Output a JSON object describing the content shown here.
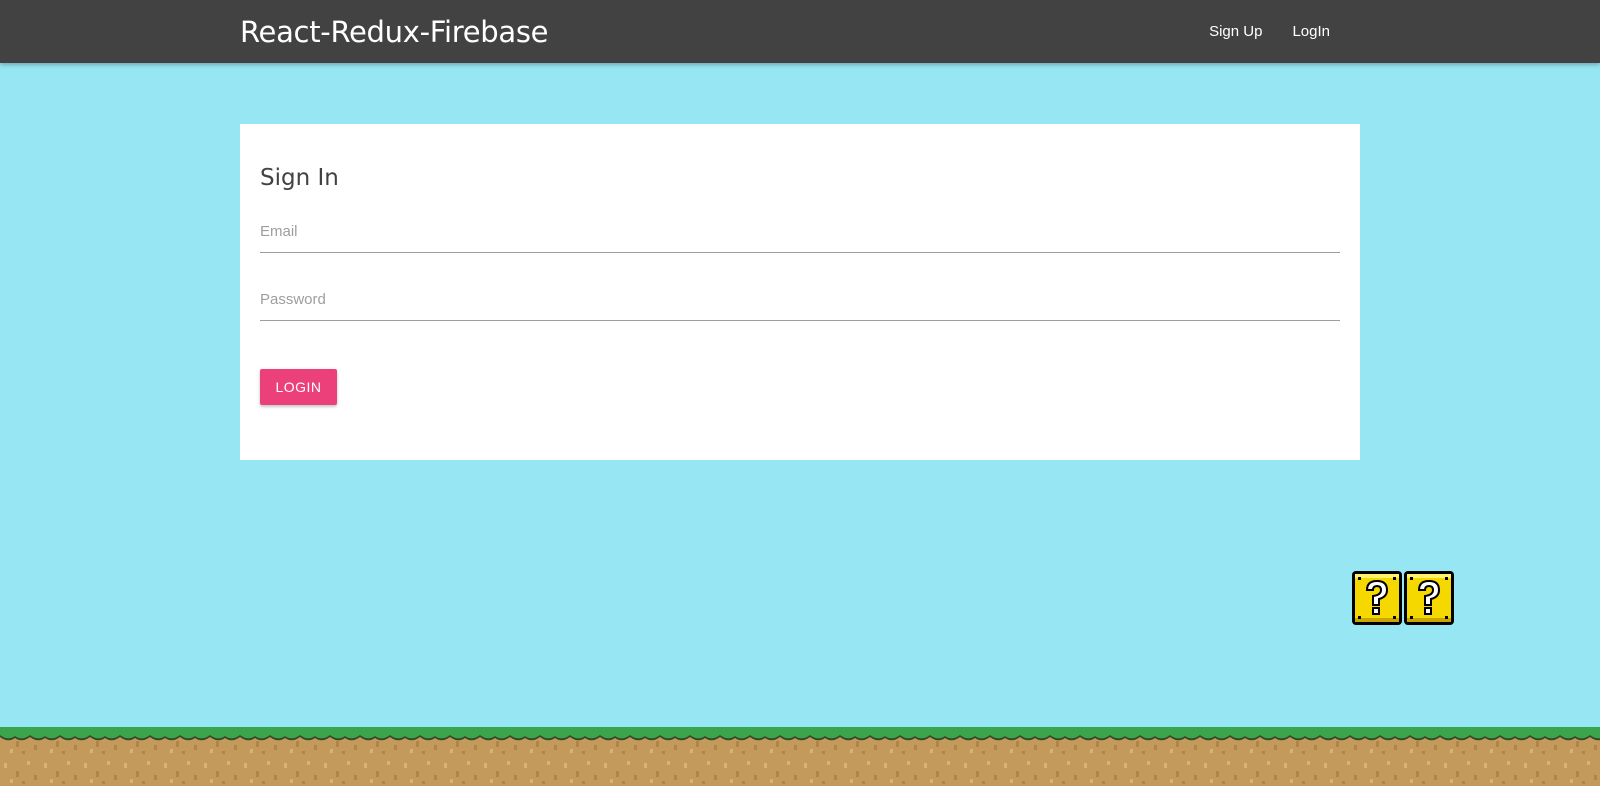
{
  "header": {
    "brand": "React-Redux-Firebase",
    "nav": [
      {
        "label": "Sign Up"
      },
      {
        "label": "LogIn"
      }
    ]
  },
  "form": {
    "title": "Sign In",
    "email": {
      "placeholder": "Email",
      "value": ""
    },
    "password": {
      "placeholder": "Password",
      "value": ""
    },
    "submit_label": "Login"
  },
  "decor": {
    "blocks": [
      "question-block-icon",
      "question-block-icon"
    ],
    "ground": "grass-dirt-ground"
  },
  "colors": {
    "navbar": "#424242",
    "background": "#96e7f3",
    "accent_button": "#ec407a",
    "card": "#ffffff",
    "grass": "#4caf50",
    "dirt": "#c49a5c"
  }
}
